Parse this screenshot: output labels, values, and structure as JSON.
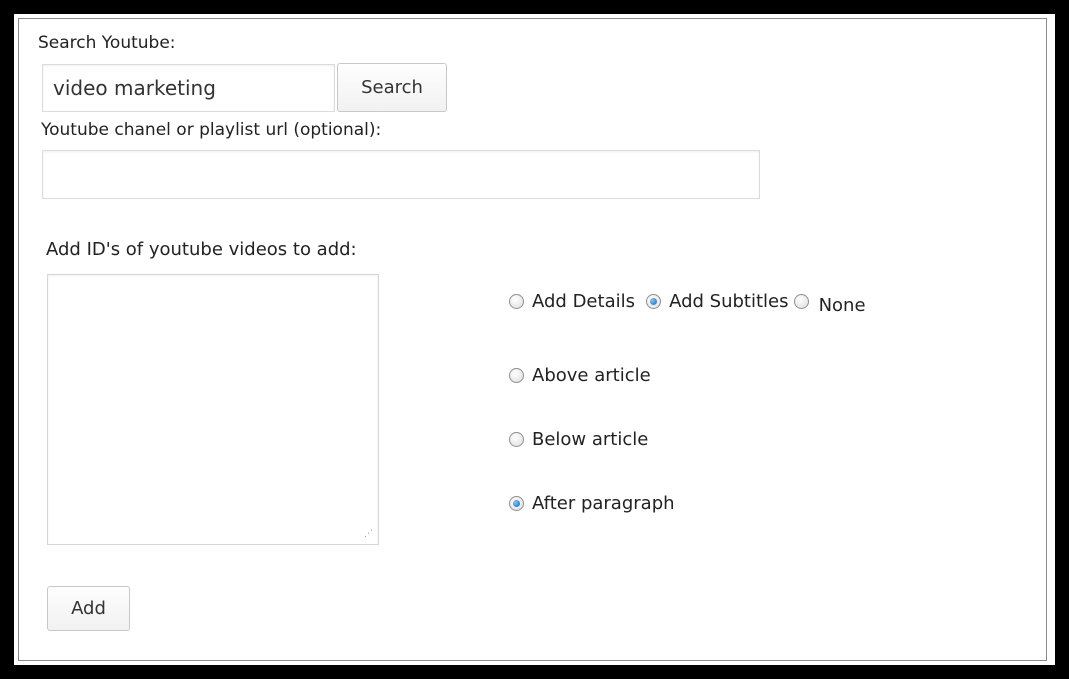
{
  "search": {
    "label": "Search Youtube:",
    "value": "video marketing",
    "button_label": "Search"
  },
  "channel": {
    "label": "Youtube chanel or playlist url (optional):",
    "value": ""
  },
  "ids": {
    "label": "Add ID's of youtube videos to add:",
    "value": ""
  },
  "details_options": [
    {
      "label": "Add Details",
      "checked": false
    },
    {
      "label": "Add Subtitles",
      "checked": true
    },
    {
      "label": "None",
      "checked": false
    }
  ],
  "position_options": [
    {
      "label": "Above article",
      "checked": false
    },
    {
      "label": "Below article",
      "checked": false
    },
    {
      "label": "After paragraph",
      "checked": true
    }
  ],
  "add_button_label": "Add",
  "colors": {
    "frame": "#000000",
    "radio_checked": "#1565b8"
  }
}
